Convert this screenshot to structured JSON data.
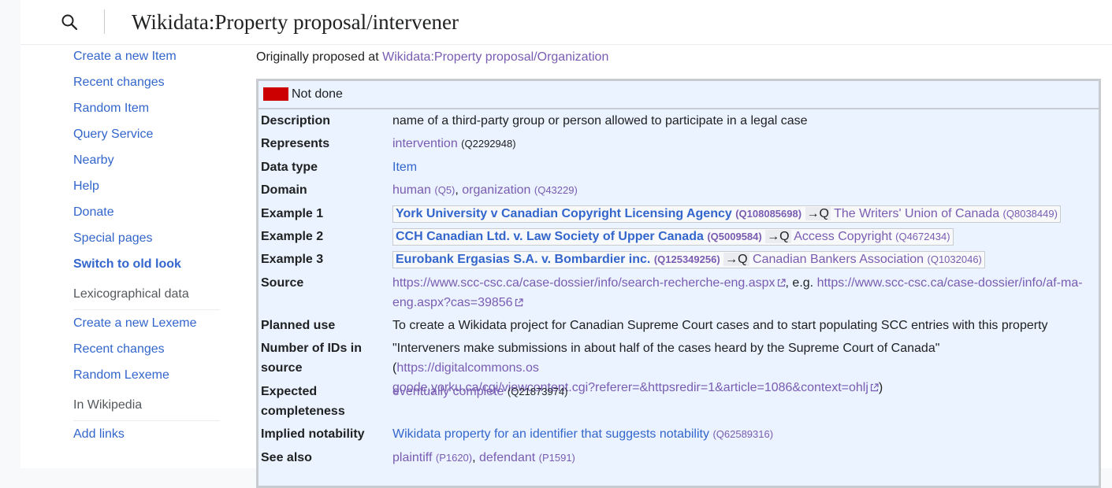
{
  "header": {
    "title": "Wikidata:Property proposal/intervener"
  },
  "sidebar": {
    "nav": [
      {
        "label": "Create a new Item"
      },
      {
        "label": "Recent changes"
      },
      {
        "label": "Random Item"
      },
      {
        "label": "Query Service"
      },
      {
        "label": "Nearby"
      },
      {
        "label": "Help"
      },
      {
        "label": "Donate"
      },
      {
        "label": "Special pages"
      },
      {
        "label": "Switch to old look"
      }
    ],
    "lexeme_heading": "Lexicographical data",
    "lexeme": [
      {
        "label": "Create a new Lexeme"
      },
      {
        "label": "Recent changes"
      },
      {
        "label": "Random Lexeme"
      }
    ],
    "wikipedia_heading": "In Wikipedia",
    "wikipedia": [
      {
        "label": "Add links"
      }
    ]
  },
  "main": {
    "orig_prefix": "Originally proposed at ",
    "orig_link": "Wikidata:Property proposal/Organization",
    "status": {
      "label": "Not done",
      "color": "#cc0000"
    },
    "rows": {
      "description": {
        "label": "Description",
        "value": "name of a third-party group or person allowed to participate in a legal case"
      },
      "represents": {
        "label": "Represents",
        "link": "intervention",
        "qid": "(Q2292948)"
      },
      "datatype": {
        "label": "Data type",
        "link": "Item"
      },
      "domain": {
        "label": "Domain",
        "link1": "human",
        "qid1": "(Q5)",
        "sep": ", ",
        "link2": "organization",
        "qid2": "(Q43229)"
      },
      "example1": {
        "label": "Example 1",
        "case": "York University v Canadian Copyright Licensing Agency",
        "case_qid": "(Q108085698)",
        "arrow": "→Q",
        "target": "The Writers' Union of Canada",
        "target_qid": "(Q8038449)"
      },
      "example2": {
        "label": "Example 2",
        "case": "CCH Canadian Ltd. v. Law Society of Upper Canada",
        "case_qid": "(Q5009584)",
        "arrow": "→Q",
        "target": "Access Copyright",
        "target_qid": "(Q4672434)"
      },
      "example3": {
        "label": "Example 3",
        "case": "Eurobank Ergasias S.A. v. Bombardier inc.",
        "case_qid": "(Q125349256)",
        "arrow": "→Q",
        "target": "Canadian Bankers Association",
        "target_qid": "(Q1032046)"
      },
      "source": {
        "label": "Source",
        "url1": "https://www.scc-csc.ca/case-dossier/info/search-recherche-eng.aspx",
        "mid": ", e.g. ",
        "url2a": "https://www.scc-csc.ca/case-dossier/info/af-ma-",
        "url2b": "eng.aspx?cas=39856"
      },
      "planned": {
        "label": "Planned use",
        "value": "To create a Wikidata project for Canadian Supreme Court cases and to start populating SCC entries with this property"
      },
      "numids": {
        "label1": "Number of IDs in",
        "label2": "source",
        "quote": "\"Interveners make submissions in about half of the cases heard by the Supreme Court of Canada\" (",
        "urla": "https://digitalcommons.os",
        "urlb": "goode.yorku.ca/cgi/viewcontent.cgi?referer=&httpsredir=1&article=1086&context=ohlj",
        "close": ")"
      },
      "expected": {
        "label1": "Expected",
        "label2": "completeness",
        "link": "eventually complete",
        "qid": "(Q21873974)"
      },
      "notability": {
        "label": "Implied notability",
        "link": "Wikidata property for an identifier that suggests notability",
        "qid": "(Q62589316)"
      },
      "seealso": {
        "label": "See also",
        "link1": "plaintiff",
        "qid1": "(P1620)",
        "sep": ", ",
        "link2": "defendant",
        "qid2": "(P1591)"
      }
    }
  }
}
